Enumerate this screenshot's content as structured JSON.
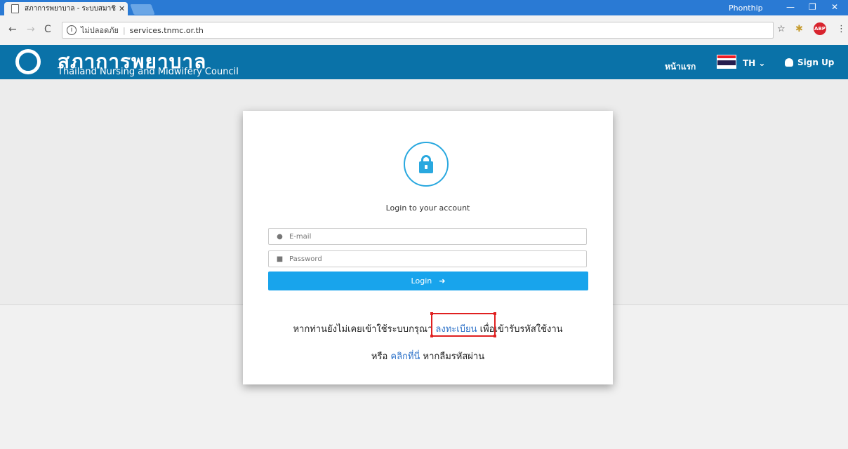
{
  "browser": {
    "tab_title": "สภาการพยาบาล - ระบบสมาชิ",
    "tab_close": "✕",
    "profile_name": "Phonthip",
    "security_text": "ไม่ปลอดภัย",
    "url": "services.tnmc.or.th"
  },
  "header": {
    "brand_th": "สภาการพยาบาล",
    "brand_en": "Thailand Nursing and Midwifery Council",
    "nav_home": "หน้าแรก",
    "language": "TH",
    "signup": "Sign Up"
  },
  "login": {
    "title": "Login to your account",
    "email_placeholder": "E-mail",
    "password_placeholder": "Password",
    "button": "Login",
    "register_prefix": "หากท่านยังไม่เคยเข้าใช้ระบบกรุณา",
    "register_link": "ลงทะเบียน",
    "register_suffix": "เพื่อเข้ารับรหัสใช้งาน",
    "forgot_prefix": "หรือ",
    "forgot_link": "คลิกที่นี่",
    "forgot_suffix": "หากลืมรหัสผ่าน"
  },
  "colors": {
    "header_bg": "#0a72a8",
    "accent": "#18a4ec",
    "link": "#2f73c9",
    "highlight": "#e02020"
  }
}
